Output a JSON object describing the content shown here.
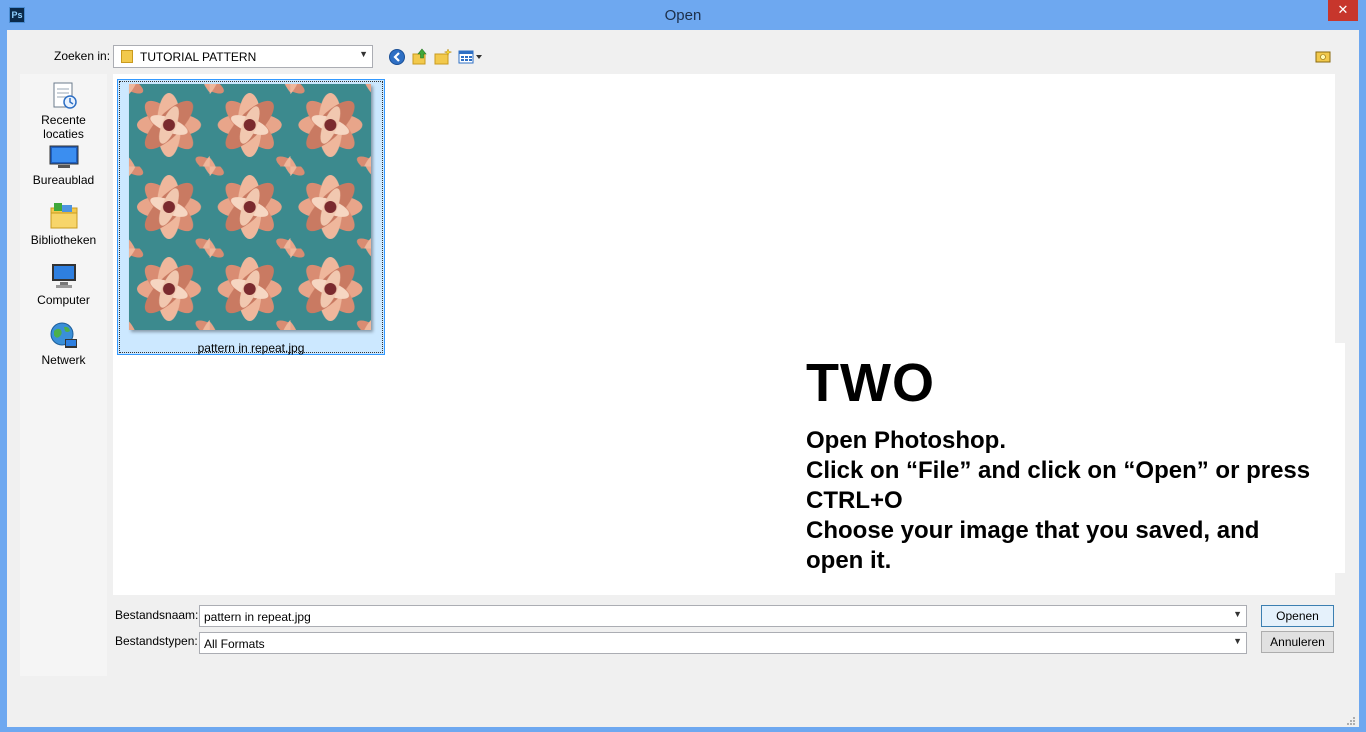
{
  "window": {
    "title": "Open",
    "app_icon_text": "Ps",
    "close_symbol": "✕"
  },
  "toolbar": {
    "lookin_label": "Zoeken in:",
    "lookin_value": "TUTORIAL PATTERN",
    "icons": [
      "back-icon",
      "up-folder-icon",
      "new-folder-icon",
      "view-menu-icon"
    ]
  },
  "places": [
    {
      "label": "Recente locaties",
      "icon": "recent-locations-icon"
    },
    {
      "label": "Bureaublad",
      "icon": "desktop-icon"
    },
    {
      "label": "Bibliotheken",
      "icon": "libraries-icon"
    },
    {
      "label": "Computer",
      "icon": "computer-icon"
    },
    {
      "label": "Netwerk",
      "icon": "network-icon"
    }
  ],
  "files": [
    {
      "name": "pattern in repeat.jpg",
      "selected": true
    }
  ],
  "overlay": {
    "heading": "TWO",
    "lines": [
      "Open Photoshop.",
      "Click on “File” and click on “Open” or press",
      "CTRL+O",
      "Choose your image that you saved, and",
      "open it."
    ]
  },
  "form": {
    "filename_label": "Bestandsnaam:",
    "filename_value": "pattern in repeat.jpg",
    "filetype_label": "Bestandstypen:",
    "filetype_value": "All Formats",
    "open_button": "Openen",
    "cancel_button": "Annuleren"
  },
  "colors": {
    "titlebar": "#6ea8f0",
    "selection": "#cce8ff",
    "close": "#c7362c"
  }
}
